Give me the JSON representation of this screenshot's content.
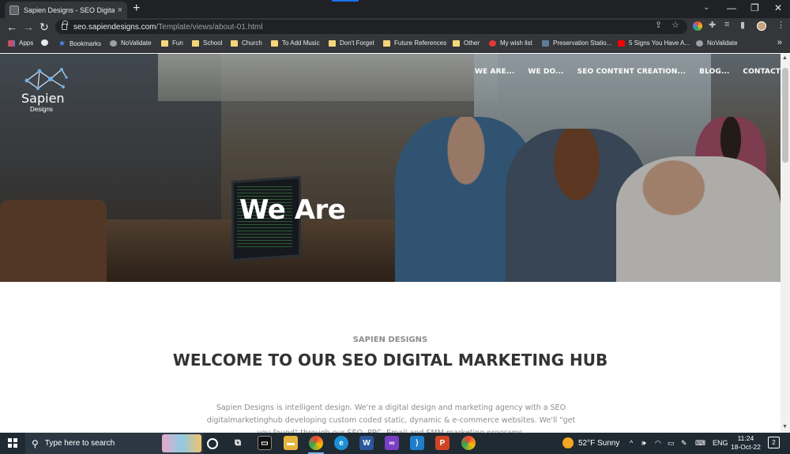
{
  "browser": {
    "tab_title": "Sapien Designs - SEO Digital Ma",
    "tab_close": "×",
    "new_tab": "+",
    "url_host": "seo.sapiendesigns.com",
    "url_path": "/Template/views/about-01.html",
    "back": "←",
    "forward": "→",
    "reload": "↻",
    "menu": "⋮"
  },
  "bookmarks": [
    {
      "label": "Apps",
      "icon": "apps-icon"
    },
    {
      "label": "",
      "icon": "github-icon"
    },
    {
      "label": "Bookmarks",
      "icon": "star-icon"
    },
    {
      "label": "NoValidate",
      "icon": "globe-icon"
    },
    {
      "label": "Fun",
      "icon": "folder-icon"
    },
    {
      "label": "School",
      "icon": "folder-icon"
    },
    {
      "label": "Church",
      "icon": "folder-icon"
    },
    {
      "label": "To Add Music",
      "icon": "folder-icon"
    },
    {
      "label": "Don't Forget",
      "icon": "folder-icon"
    },
    {
      "label": "Future References",
      "icon": "folder-icon"
    },
    {
      "label": "Other",
      "icon": "folder-icon"
    },
    {
      "label": "My wish list",
      "icon": "wishlist-icon"
    },
    {
      "label": "Preservation Statio...",
      "icon": "preservation-icon"
    },
    {
      "label": "5 Signs You Have A...",
      "icon": "youtube-icon"
    },
    {
      "label": "NoValidate",
      "icon": "globe-icon"
    }
  ],
  "bookmarks_more": "»",
  "site": {
    "logo_name": "Sapien",
    "logo_sub": "Designs",
    "nav": [
      "WE ARE...",
      "WE DO...",
      "SEO CONTENT CREATION...",
      "BLOG...",
      "CONTACT US..."
    ],
    "hero_title": "We Are",
    "eyebrow": "SAPIEN DESIGNS",
    "headline": "WELCOME TO OUR SEO DIGITAL MARKETING HUB",
    "intro": "Sapien Designs is intelligent design. We're a digital design and marketing agency with a SEO digitalmarketinghub developing custom coded static, dynamic & e-commerce websites. We'll \"get you found\" through our SEO, PPC, Email and SMM marketing programs."
  },
  "taskbar": {
    "search_placeholder": "Type here to search",
    "weather": "52°F  Sunny",
    "language": "ENG",
    "time": "11:24",
    "date": "18-Oct-22",
    "notifications": "2"
  },
  "colors": {
    "chrome_dark": "#202124",
    "chrome_toolbar": "#35363a",
    "taskbar": "#1f2a33",
    "headline": "#333333",
    "eyebrow": "#8d8d8d"
  }
}
